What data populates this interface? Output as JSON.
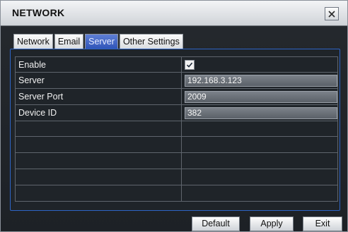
{
  "window": {
    "title": "NETWORK"
  },
  "tabs": [
    {
      "label": "Network",
      "active": false
    },
    {
      "label": "Email",
      "active": false
    },
    {
      "label": "Server",
      "active": true
    },
    {
      "label": "Other Settings",
      "active": false
    }
  ],
  "settings": {
    "enable_label": "Enable",
    "enable_checked": true,
    "server_label": "Server",
    "server_value": "192.168.3.123",
    "port_label": "Server Port",
    "port_value": "2009",
    "device_label": "Device ID",
    "device_value": "382"
  },
  "buttons": {
    "default": "Default",
    "apply": "Apply",
    "exit": "Exit"
  },
  "colors": {
    "accent": "#2f55b8",
    "panel_border": "#2e64c5"
  }
}
